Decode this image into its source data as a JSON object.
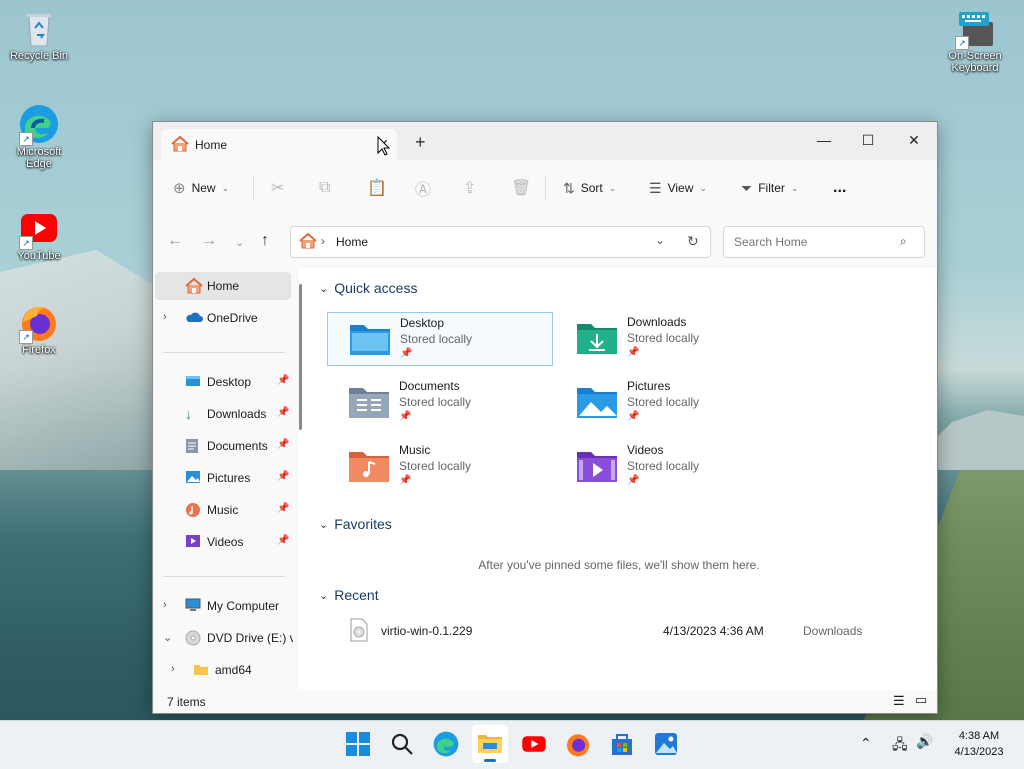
{
  "desktop": {
    "icons": [
      {
        "label": "Recycle Bin"
      },
      {
        "label": "Microsoft Edge"
      },
      {
        "label": "YouTube"
      },
      {
        "label": "Firefox"
      },
      {
        "label": "On-Screen Keyboard"
      }
    ]
  },
  "explorer": {
    "tab_title": "Home",
    "toolbar": {
      "new_label": "New",
      "sort_label": "Sort",
      "view_label": "View",
      "filter_label": "Filter",
      "more_label": "..."
    },
    "address": {
      "location": "Home"
    },
    "search": {
      "placeholder": "Search Home"
    },
    "sidebar": {
      "home": "Home",
      "onedrive": "OneDrive",
      "pinned": [
        {
          "label": "Desktop"
        },
        {
          "label": "Downloads"
        },
        {
          "label": "Documents"
        },
        {
          "label": "Pictures"
        },
        {
          "label": "Music"
        },
        {
          "label": "Videos"
        }
      ],
      "my_computer": "My Computer",
      "dvd_drive": "DVD Drive (E:) vi",
      "amd64": "amd64"
    },
    "quick_access": {
      "title": "Quick access",
      "items": [
        {
          "name": "Desktop",
          "status": "Stored locally"
        },
        {
          "name": "Downloads",
          "status": "Stored locally"
        },
        {
          "name": "Documents",
          "status": "Stored locally"
        },
        {
          "name": "Pictures",
          "status": "Stored locally"
        },
        {
          "name": "Music",
          "status": "Stored locally"
        },
        {
          "name": "Videos",
          "status": "Stored locally"
        }
      ]
    },
    "favorites": {
      "title": "Favorites",
      "empty_message": "After you've pinned some files, we'll show them here."
    },
    "recent": {
      "title": "Recent",
      "items": [
        {
          "name": "virtio-win-0.1.229",
          "date": "4/13/2023 4:36 AM",
          "location": "Downloads"
        }
      ]
    },
    "status_bar": {
      "items_count": "7 items"
    }
  },
  "taskbar": {
    "time": "4:38 AM",
    "date": "4/13/2023"
  }
}
